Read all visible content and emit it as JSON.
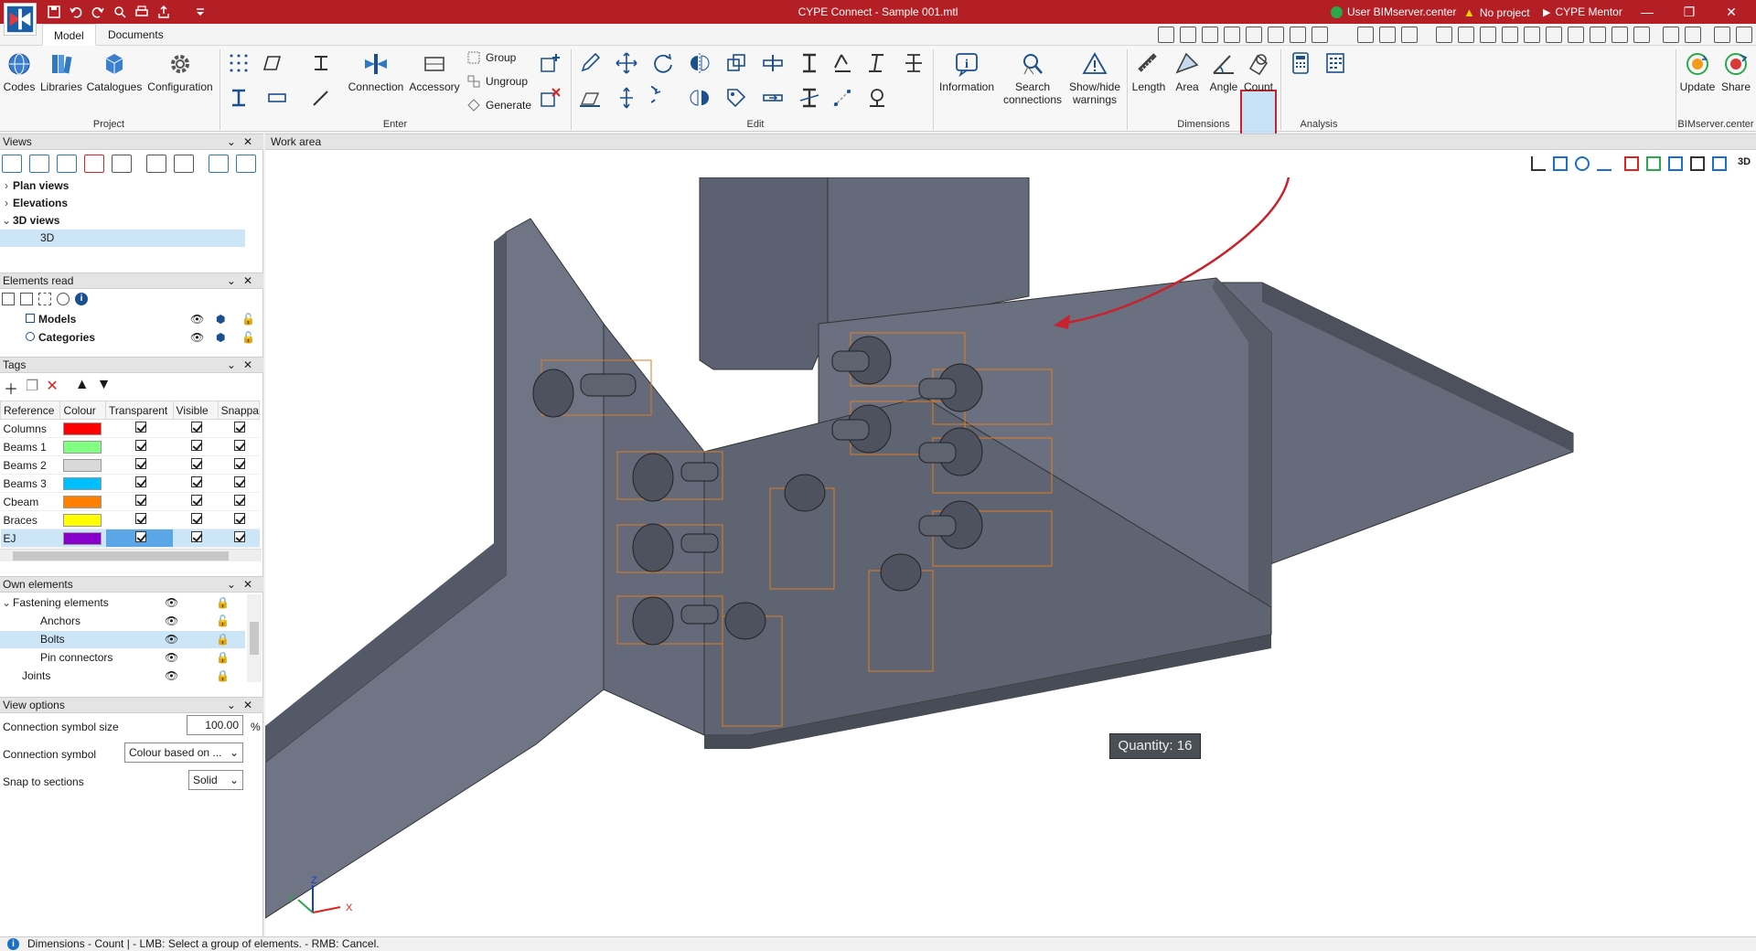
{
  "titlebar": {
    "title": "CYPE Connect - Sample 001.mtl",
    "user": "User BIMserver.center",
    "project_status": "No project",
    "mentor": "CYPE Mentor",
    "accent": "#b31f24"
  },
  "tabs": {
    "model": "Model",
    "documents": "Documents"
  },
  "ribbon": {
    "project": {
      "label": "Project",
      "codes": "Codes",
      "libraries": "Libraries",
      "catalogues": "Catalogues",
      "configuration": "Configuration"
    },
    "enter": {
      "label": "Enter",
      "connection": "Connection",
      "accessory": "Accessory",
      "group": "Group",
      "ungroup": "Ungroup",
      "generate": "Generate"
    },
    "edit": {
      "label": "Edit"
    },
    "info": {
      "information": "Information",
      "search_connections": "Search\nconnections",
      "show_hide_warnings": "Show/hide\nwarnings"
    },
    "dimensions": {
      "label": "Dimensions",
      "length": "Length",
      "area": "Area",
      "angle": "Angle",
      "count": "Count"
    },
    "analysis": {
      "label": "Analysis"
    },
    "bimserver": {
      "label": "BIMserver.center",
      "update": "Update",
      "share": "Share"
    }
  },
  "views_panel": {
    "title": "Views",
    "items": [
      {
        "label": "Plan views",
        "expanded": false
      },
      {
        "label": "Elevations",
        "expanded": false
      },
      {
        "label": "3D views",
        "expanded": true
      },
      {
        "label": "3D",
        "child": true,
        "selected": true
      }
    ]
  },
  "elements_read": {
    "title": "Elements read",
    "items": [
      {
        "label": "Models"
      },
      {
        "label": "Categories"
      }
    ]
  },
  "tags_panel": {
    "title": "Tags",
    "columns": [
      "Reference",
      "Colour",
      "Transparent",
      "Visible",
      "Snappa"
    ],
    "rows": [
      {
        "reference": "Columns",
        "color": "#ff0000"
      },
      {
        "reference": "Beams 1",
        "color": "#80ff80"
      },
      {
        "reference": "Beams 2",
        "color": "#d9d9d9"
      },
      {
        "reference": "Beams 3",
        "color": "#00bfff"
      },
      {
        "reference": "Cbeam",
        "color": "#ff8000"
      },
      {
        "reference": "Braces",
        "color": "#ffff00"
      },
      {
        "reference": "EJ",
        "color": "#8800cc",
        "selected": true
      }
    ]
  },
  "own_elements": {
    "title": "Own elements",
    "items": [
      {
        "label": "Fastening elements",
        "expanded": true
      },
      {
        "label": "Anchors",
        "child": true
      },
      {
        "label": "Bolts",
        "child": true,
        "selected": true
      },
      {
        "label": "Pin connectors",
        "child": true
      },
      {
        "label": "Joints"
      }
    ]
  },
  "view_options": {
    "title": "View options",
    "symbol_size_label": "Connection symbol size",
    "symbol_size_value": "100.00",
    "symbol_size_unit": "%",
    "symbol_label": "Connection symbol",
    "symbol_value": "Colour based on ...",
    "snap_label": "Snap to sections",
    "snap_value": "Solid"
  },
  "work_area": {
    "title": "Work area",
    "tooltip": "Quantity: 16",
    "axes": {
      "x": "X",
      "y": "Y",
      "z": "Z"
    }
  },
  "status": {
    "text": "Dimensions - Count  |  - LMB: Select a group of elements. - RMB: Cancel."
  }
}
